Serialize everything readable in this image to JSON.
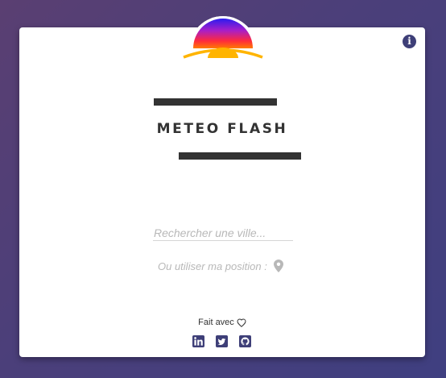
{
  "app": {
    "title": "METEO FLASH",
    "logo_icon": "sunset-logo-icon",
    "info_icon": "info-icon"
  },
  "search": {
    "placeholder": "Rechercher une ville...",
    "value": ""
  },
  "geolocation": {
    "label": "Ou utiliser ma position :",
    "icon": "map-pin-icon"
  },
  "footer": {
    "made_with": "Fait avec",
    "heart_icon": "heart-icon",
    "socials": [
      {
        "icon": "linkedin-icon"
      },
      {
        "icon": "twitter-icon"
      },
      {
        "icon": "github-icon"
      }
    ]
  },
  "colors": {
    "background_start": "#5a3f72",
    "background_end": "#3f3f80",
    "card": "#ffffff",
    "accent": "#3e3f78",
    "title": "#333333",
    "muted_text": "#b8b8b8",
    "logo_gradient": [
      "#2b1cf0",
      "#a81ec8",
      "#ff2a3c",
      "#ff7a00"
    ],
    "logo_sun": "#ffb400"
  }
}
